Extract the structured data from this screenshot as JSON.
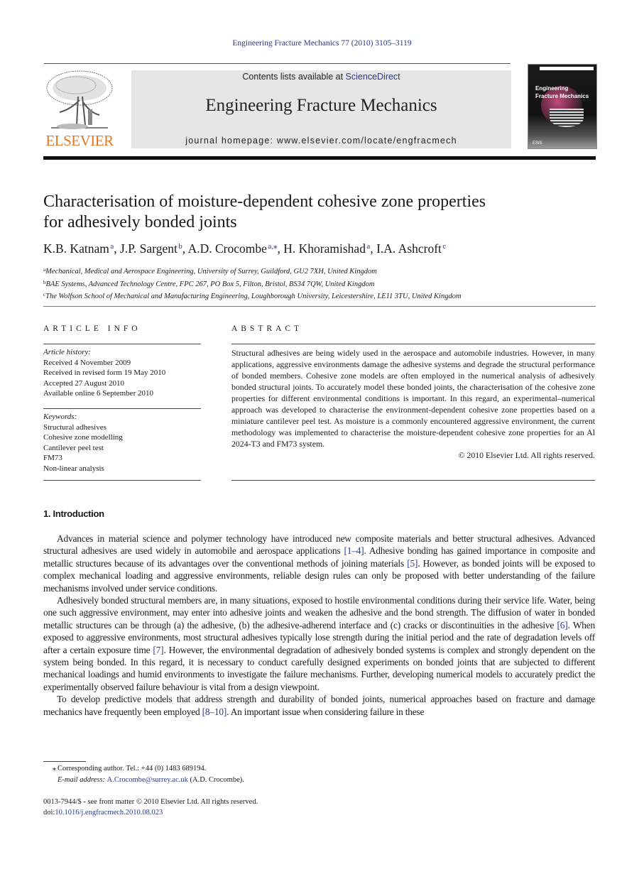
{
  "running_head": "Engineering Fracture Mechanics 77 (2010) 3105–3119",
  "masthead": {
    "publisher_logo_text": "ELSEVIER",
    "contents_prefix": "Contents lists available at ",
    "contents_link": "ScienceDirect",
    "journal_title": "Engineering Fracture Mechanics",
    "homepage": "journal homepage: www.elsevier.com/locate/engfracmech",
    "cover_title_line1": "Engineering",
    "cover_title_line2": "Fracture Mechanics",
    "cover_publisher": "ESIS"
  },
  "article": {
    "title_line1": "Characterisation of moisture-dependent cohesive zone properties",
    "title_line2": "for adhesively bonded joints",
    "authors": [
      {
        "name": "K.B. Katnam",
        "sup": "a",
        "sep": ", "
      },
      {
        "name": "J.P. Sargent",
        "sup": "b",
        "sep": ", "
      },
      {
        "name": "A.D. Crocombe",
        "sup": "a,⁎",
        "sep": ", "
      },
      {
        "name": "H. Khoramishad",
        "sup": "a",
        "sep": ", "
      },
      {
        "name": "I.A. Ashcroft",
        "sup": "c",
        "sep": ""
      }
    ],
    "affiliations": [
      {
        "key": "a",
        "text": "Mechanical, Medical and Aerospace Engineering, University of Surrey, Guildford, GU2 7XH, United Kingdom"
      },
      {
        "key": "b",
        "text": "BAE Systems, Advanced Technology Centre, FPC 267, PO Box 5, Filton, Bristol, BS34 7QW, United Kingdom"
      },
      {
        "key": "c",
        "text": "The Wolfson School of Mechanical and Manufacturing Engineering, Loughborough University, Leicestershire, LE11 3TU, United Kingdom"
      }
    ]
  },
  "article_info": {
    "heading": "ARTICLE INFO",
    "history_label": "Article history:",
    "history": [
      "Received 4 November 2009",
      "Received in revised form 19 May 2010",
      "Accepted 27 August 2010",
      "Available online 6 September 2010"
    ],
    "keywords_label": "Keywords:",
    "keywords": [
      "Structural adhesives",
      "Cohesive zone modelling",
      "Cantilever peel test",
      "FM73",
      "Non-linear analysis"
    ]
  },
  "abstract": {
    "heading": "ABSTRACT",
    "text": "Structural adhesives are being widely used in the aerospace and automobile industries. However, in many applications, aggressive environments damage the adhesive systems and degrade the structural performance of bonded members. Cohesive zone models are often employed in the numerical analysis of adhesively bonded structural joints. To accurately model these bonded joints, the characterisation of the cohesive zone properties for different environmental conditions is important. In this regard, an experimental–numerical approach was developed to characterise the environment-dependent cohesive zone properties based on a miniature cantilever peel test. As moisture is a commonly encountered aggressive environment, the current methodology was implemented to characterise the moisture-dependent cohesive zone properties for an Al 2024-T3 and FM73 system.",
    "copyright": "© 2010 Elsevier Ltd. All rights reserved."
  },
  "introduction": {
    "heading": "1. Introduction",
    "p1": [
      "Advances in material science and polymer technology have introduced new composite materials and better structural adhesives. Advanced structural adhesives are used widely in automobile and aerospace applications ",
      "[1–4]",
      ". Adhesive bonding has gained importance in composite and metallic structures because of its advantages over the conventional methods of joining materials ",
      "[5]",
      ". However, as bonded joints will be exposed to complex mechanical loading and aggressive environments, reliable design rules can only be proposed with better understanding of the failure mechanisms involved under service conditions."
    ],
    "p2": [
      "Adhesively bonded structural members are, in many situations, exposed to hostile environmental conditions during their service life. Water, being one such aggressive environment, may enter into adhesive joints and weaken the adhesive and the bond strength. The diffusion of water in bonded metallic structures can be through (a) the adhesive, (b) the adhesive-adherend interface and (c) cracks or discontinuities in the adhesive ",
      "[6]",
      ". When exposed to aggressive environments, most structural adhesives typically lose strength during the initial period and the rate of degradation levels off after a certain exposure time ",
      "[7]",
      ". However, the environmental degradation of adhesively bonded systems is complex and strongly dependent on the system being bonded. In this regard, it is necessary to conduct carefully designed experiments on bonded joints that are subjected to different mechanical loadings and humid environments to investigate the failure mechanisms. Further, developing numerical models to accurately predict the experimentally observed failure behaviour is vital from a design viewpoint."
    ],
    "p3": [
      "To develop predictive models that address strength and durability of bonded joints, numerical approaches based on fracture and damage mechanics have frequently been employed ",
      "[8–10]",
      ". An important issue when considering failure in these"
    ]
  },
  "footnotes": {
    "star": "⁎",
    "corresponding": "Corresponding author. Tel.: +44 (0) 1483 689194.",
    "email_label": "E-mail address: ",
    "email": "A.Crocombe@surrey.ac.uk",
    "email_suffix": " (A.D. Crocombe)."
  },
  "bottom": {
    "issn": "0013-7944/$ - see front matter © 2010 Elsevier Ltd. All rights reserved.",
    "doi_label": "doi:",
    "doi": "10.1016/j.engfracmech.2010.08.023"
  }
}
